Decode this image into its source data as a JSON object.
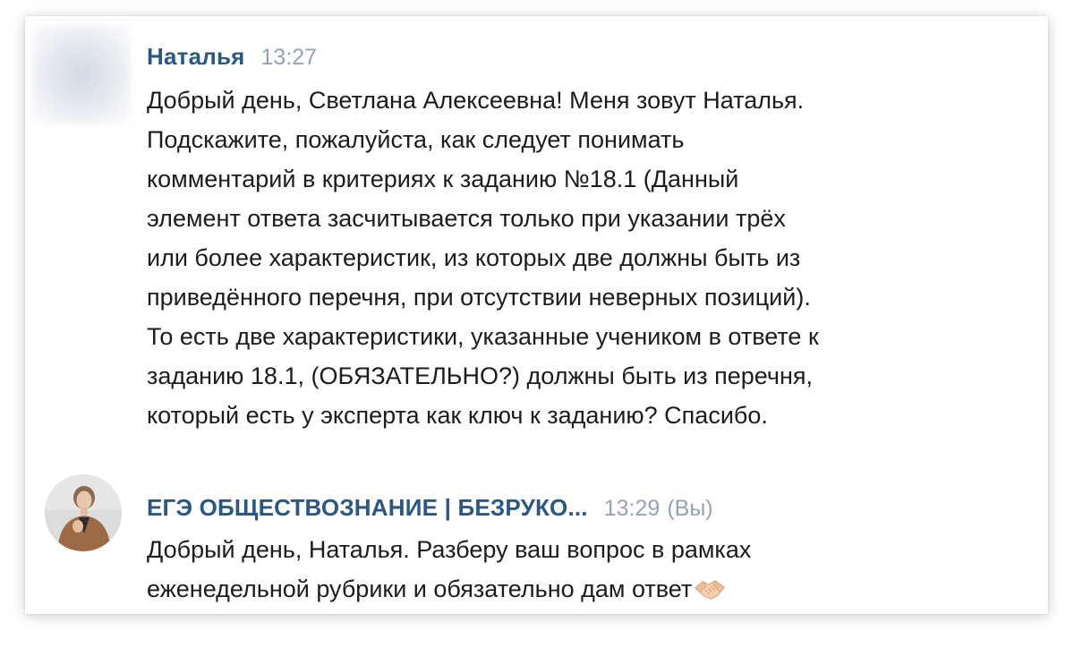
{
  "messages": [
    {
      "author": "Наталья",
      "time": "13:27",
      "avatar": "blurred-avatar",
      "lines": [
        "Добрый день, Светлана Алексеевна! Меня зовут Наталья.",
        "Подскажите, пожалуйста, как следует понимать",
        "комментарий в критериях к заданию №18.1 (Данный",
        "элемент ответа засчитывается только при указании трёх",
        "или более характеристик, из которых две должны быть из",
        "приведённого перечня, при отсутствии неверных позиций).",
        "То есть две характеристики, указанные учеником в ответе к",
        "заданию 18.1, (ОБЯЗАТЕЛЬНО?) должны быть из перечня,",
        "который есть у эксперта как ключ к заданию? Спасибо."
      ]
    },
    {
      "author": "ЕГЭ ОБЩЕСТВОЗНАНИЕ | БЕЗРУКО...",
      "time": "13:29",
      "you_label": "(Вы)",
      "avatar": "profile-photo",
      "lines": [
        "Добрый день, Наталья. Разберу ваш вопрос в рамках",
        "еженедельной рубрики и обязательно дам ответ"
      ],
      "trailing_icon": "handshake-emoji"
    }
  ],
  "colors": {
    "author": "#2a5885",
    "time": "#93a3b3",
    "text": "#1c1c1c"
  }
}
